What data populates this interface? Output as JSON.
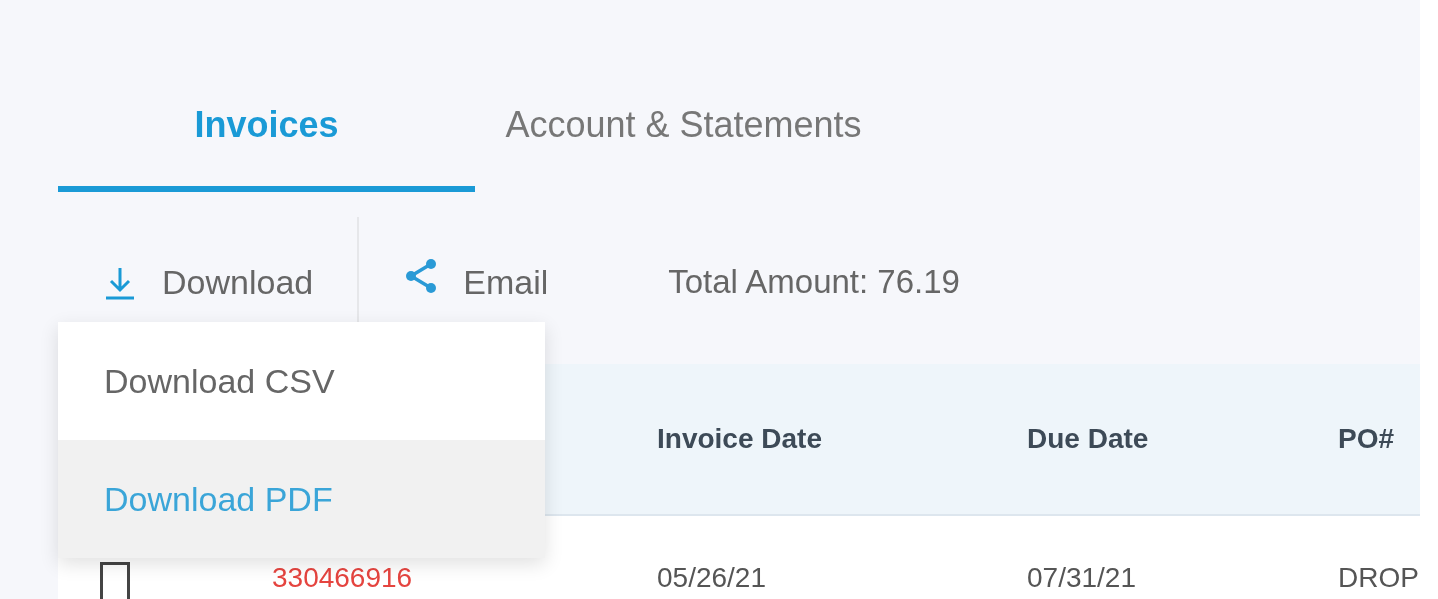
{
  "tabs": [
    {
      "label": "Invoices",
      "selected": true
    },
    {
      "label": "Account & Statements",
      "selected": false
    }
  ],
  "toolbar": {
    "download": "Download",
    "email": "Email",
    "total": "Total Amount: 76.19"
  },
  "download_menu": [
    {
      "label": "Download CSV",
      "selected": false
    },
    {
      "label": "Download PDF",
      "selected": true
    }
  ],
  "table": {
    "columns": [
      "Invoice Date",
      "Due Date",
      "PO#"
    ],
    "rows": [
      {
        "checked": false,
        "invoice": "330466916",
        "invoice_date": "05/26/21",
        "due_date": "07/31/21",
        "po": "DROP"
      }
    ]
  }
}
